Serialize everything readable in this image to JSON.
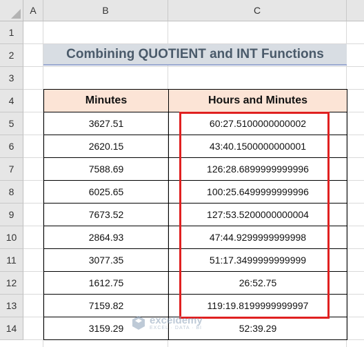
{
  "columns": [
    "A",
    "B",
    "C"
  ],
  "rows": [
    "1",
    "2",
    "3",
    "4",
    "5",
    "6",
    "7",
    "8",
    "9",
    "10",
    "11",
    "12",
    "13",
    "14"
  ],
  "title": "Combining QUOTIENT and INT Functions",
  "table": {
    "headers": [
      "Minutes",
      "Hours and Minutes"
    ],
    "rows": [
      {
        "minutes": "3627.51",
        "hm": "60:27.5100000000002"
      },
      {
        "minutes": "2620.15",
        "hm": "43:40.1500000000001"
      },
      {
        "minutes": "7588.69",
        "hm": "126:28.6899999999996"
      },
      {
        "minutes": "6025.65",
        "hm": "100:25.6499999999996"
      },
      {
        "minutes": "7673.52",
        "hm": "127:53.5200000000004"
      },
      {
        "minutes": "2864.93",
        "hm": "47:44.9299999999998"
      },
      {
        "minutes": "3077.35",
        "hm": "51:17.3499999999999"
      },
      {
        "minutes": "1612.75",
        "hm": "26:52.75"
      },
      {
        "minutes": "7159.82",
        "hm": "119:19.8199999999997"
      },
      {
        "minutes": "3159.29",
        "hm": "52:39.29"
      }
    ]
  },
  "watermark": {
    "name": "exceldemy",
    "tagline": "EXCEL · DATA · BI"
  },
  "colors": {
    "header_fill": "#fce4d6",
    "title_fill": "#d8dde3",
    "highlight": "#e02020"
  }
}
